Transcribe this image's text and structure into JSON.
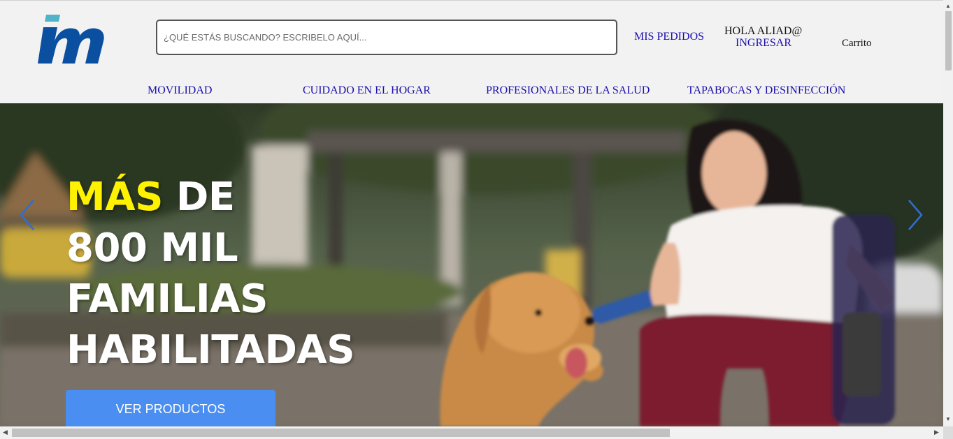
{
  "header": {
    "logo_alt": "im",
    "search_placeholder": "¿QUÉ ESTÁS BUSCANDO? ESCRIBELO AQUÍ...",
    "mis_pedidos": "MIS PEDIDOS",
    "greeting": "HOLA ALIAD@",
    "login": "INGRESAR",
    "cart": "Carrito"
  },
  "nav": {
    "items": [
      {
        "label": "MOVILIDAD"
      },
      {
        "label": "CUIDADO EN EL HOGAR"
      },
      {
        "label": "PROFESIONALES DE LA SALUD"
      },
      {
        "label": "TAPABOCAS Y DESINFECCIÓN"
      }
    ]
  },
  "hero": {
    "headline_highlight": "MÁS",
    "headline_rest_line1": " DE",
    "headline_line2": "800 MIL",
    "headline_line3": "FAMILIAS",
    "headline_line4": "HABILITADAS",
    "cta": "VER PRODUCTOS",
    "prev_icon": "chevron-left-icon",
    "next_icon": "chevron-right-icon"
  },
  "colors": {
    "link": "#1a0dab",
    "highlight": "#fff200",
    "cta_bg": "#4a8ef2",
    "logo_blue": "#0b4fa0",
    "logo_teal": "#4fb3c9"
  }
}
